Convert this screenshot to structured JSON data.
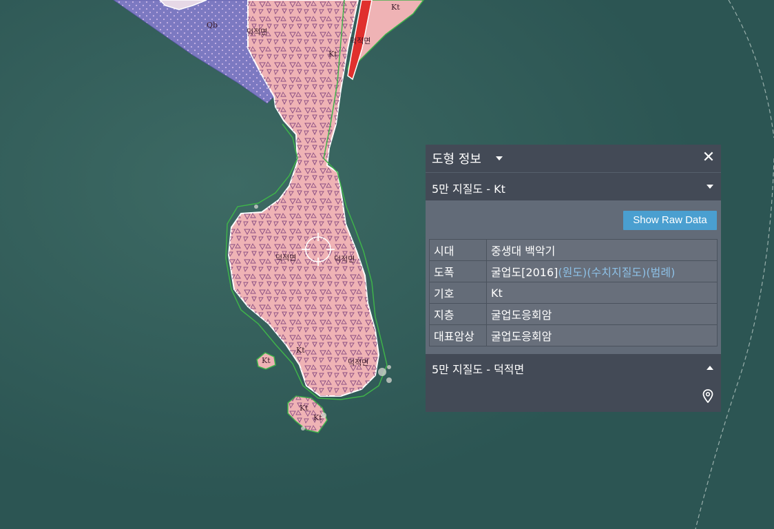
{
  "map": {
    "labels": {
      "qb": "Qb",
      "kt": "Kt",
      "deokjeok": "덕적면"
    },
    "colors": {
      "sea": "#2f5a57",
      "unit_kt": "#f0b4b4",
      "unit_qb": "#7c79c1",
      "dike": "#e0302e",
      "outline": "#ffffff",
      "coast": "#3fb34a"
    }
  },
  "panel": {
    "title": "도형 정보",
    "close_glyph": "✕",
    "layer_title": "5만 지질도 - Kt",
    "raw_button": "Show Raw Data",
    "rows": [
      {
        "key": "시대",
        "value": "중생대 백악기"
      },
      {
        "key": "도폭",
        "value": "굴업도[2016]",
        "links": [
          "(원도)",
          "(수치지질도)",
          "(범례)"
        ]
      },
      {
        "key": "기호",
        "value": "Kt"
      },
      {
        "key": "지층",
        "value": "굴업도응회암"
      },
      {
        "key": "대표암상",
        "value": "굴업도응회암"
      }
    ],
    "section2_title": "5만 지질도 - 덕적면",
    "section2_icon": "map-pin-icon"
  }
}
